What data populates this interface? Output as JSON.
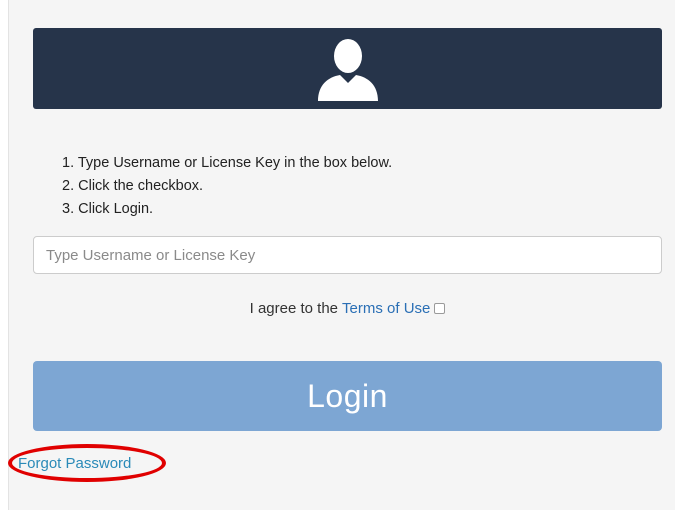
{
  "header": {
    "icon": "user-silhouette-icon",
    "background_color": "#26344a"
  },
  "instructions": [
    "1. Type Username or License Key in the box below.",
    "2. Click the checkbox.",
    "3. Click Login."
  ],
  "username_input": {
    "placeholder": "Type Username or License Key",
    "value": ""
  },
  "agreement": {
    "prefix": "I agree to the",
    "link_text": "Terms of Use",
    "checked": false
  },
  "login_button": {
    "label": "Login",
    "color": "#7da6d3"
  },
  "forgot_password": {
    "label": "Forgot Password",
    "link_color": "#2a8ab8"
  },
  "annotation": {
    "highlight_color": "#e00000"
  }
}
